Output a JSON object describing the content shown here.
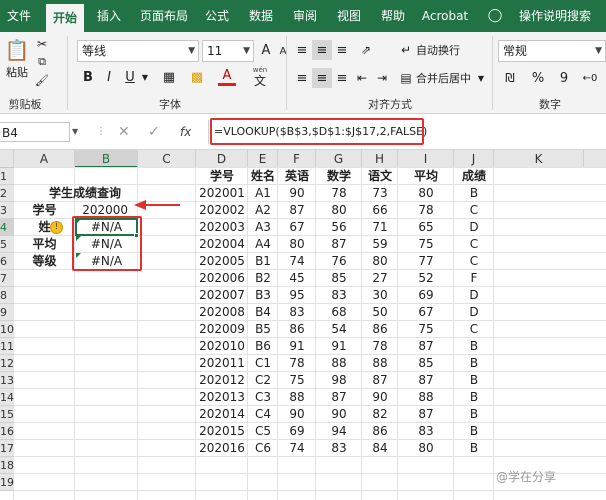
{
  "tabs": [
    "文件",
    "开始",
    "插入",
    "页面布局",
    "公式",
    "数据",
    "审阅",
    "视图",
    "帮助",
    "Acrobat",
    "操作说明搜索"
  ],
  "ribbon": {
    "paste_label": "粘贴",
    "clipboard_label": "剪贴板",
    "font_name": "等线",
    "font_size": "11",
    "font_label": "字体",
    "bold": "B",
    "italic": "I",
    "underline": "U",
    "font_grow": "A",
    "font_shrink": "A",
    "wen_label": "wén",
    "wen_char": "文",
    "align_label": "对齐方式",
    "wrap_label": "自动换行",
    "merge_label": "合并后居中",
    "number_format": "常规",
    "number_label": "数字",
    "percent": "%",
    "comma": "9"
  },
  "formula_bar": {
    "name_box": "B4",
    "fx": "fx",
    "formula": "=VLOOKUP($B$3,$D$1:$J$17,2,FALSE)"
  },
  "columns": [
    "A",
    "B",
    "C",
    "D",
    "E",
    "F",
    "G",
    "H",
    "I",
    "J",
    "K"
  ],
  "rows": [
    "1",
    "2",
    "3",
    "4",
    "5",
    "6",
    "7",
    "8",
    "9",
    "10",
    "11",
    "12",
    "13",
    "14",
    "15",
    "16",
    "17",
    "18",
    "19"
  ],
  "query": {
    "title": "学生成绩查询",
    "id_label": "学号",
    "id_value": "202000",
    "name_label": "姓",
    "avg_label": "平均",
    "grade_label": "等级",
    "na": "#N/A"
  },
  "headers": [
    "学号",
    "姓名",
    "英语",
    "数学",
    "语文",
    "平均",
    "成绩"
  ],
  "table": [
    [
      "202001",
      "A1",
      "90",
      "78",
      "73",
      "80",
      "B"
    ],
    [
      "202002",
      "A2",
      "87",
      "80",
      "66",
      "78",
      "C"
    ],
    [
      "202003",
      "A3",
      "67",
      "56",
      "71",
      "65",
      "D"
    ],
    [
      "202004",
      "A4",
      "80",
      "87",
      "59",
      "75",
      "C"
    ],
    [
      "202005",
      "B1",
      "74",
      "76",
      "80",
      "77",
      "C"
    ],
    [
      "202006",
      "B2",
      "45",
      "85",
      "27",
      "52",
      "F"
    ],
    [
      "202007",
      "B3",
      "95",
      "83",
      "30",
      "69",
      "D"
    ],
    [
      "202008",
      "B4",
      "83",
      "68",
      "50",
      "67",
      "D"
    ],
    [
      "202009",
      "B5",
      "86",
      "54",
      "86",
      "75",
      "C"
    ],
    [
      "202010",
      "B6",
      "91",
      "91",
      "78",
      "87",
      "B"
    ],
    [
      "202011",
      "C1",
      "78",
      "88",
      "88",
      "85",
      "B"
    ],
    [
      "202012",
      "C2",
      "75",
      "98",
      "87",
      "87",
      "B"
    ],
    [
      "202013",
      "C3",
      "88",
      "87",
      "90",
      "88",
      "B"
    ],
    [
      "202014",
      "C4",
      "90",
      "90",
      "82",
      "87",
      "B"
    ],
    [
      "202015",
      "C5",
      "69",
      "94",
      "86",
      "83",
      "B"
    ],
    [
      "202016",
      "C6",
      "74",
      "83",
      "84",
      "80",
      "B"
    ]
  ],
  "watermark": "@学在分享"
}
